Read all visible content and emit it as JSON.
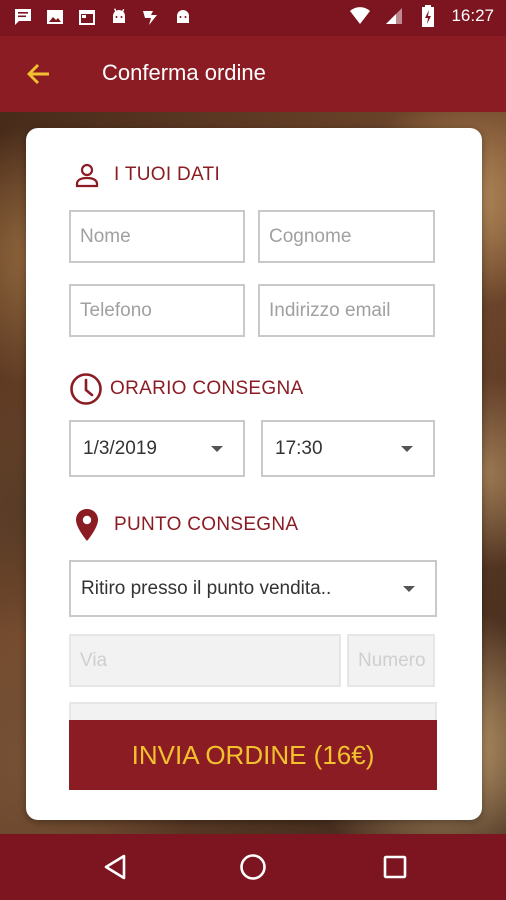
{
  "status_bar": {
    "time": "16:27",
    "icons": [
      "message-icon",
      "image-icon",
      "calendar-icon",
      "android-icon",
      "check-icon",
      "android-icon",
      "wifi-icon",
      "signal-icon",
      "battery-icon"
    ]
  },
  "app_bar": {
    "title": "Conferma ordine",
    "back_icon": "arrow-left-icon"
  },
  "sections": {
    "personal": {
      "label": "I TUOI DATI",
      "icon": "person-icon",
      "fields": {
        "first_name": {
          "placeholder": "Nome",
          "value": ""
        },
        "last_name": {
          "placeholder": "Cognome",
          "value": ""
        },
        "phone": {
          "placeholder": "Telefono",
          "value": ""
        },
        "email": {
          "placeholder": "Indirizzo email",
          "value": ""
        }
      }
    },
    "delivery_time": {
      "label": "ORARIO CONSEGNA",
      "icon": "clock-icon",
      "date": "1/3/2019",
      "time": "17:30"
    },
    "delivery_point": {
      "label": "PUNTO CONSEGNA",
      "icon": "location-pin-icon",
      "selected": "Ritiro presso il punto vendita..",
      "street_placeholder": "Via",
      "number_placeholder": "Numero"
    }
  },
  "submit_label": "INVIA ORDINE (16€)",
  "colors": {
    "primary": "#8c1c24",
    "status_bar": "#7c151f",
    "accent": "#f2c12e"
  }
}
